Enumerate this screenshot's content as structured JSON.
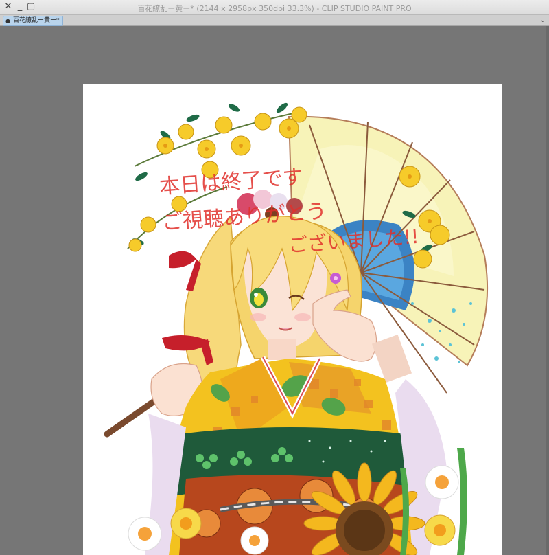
{
  "window": {
    "title": "百花繚乱ー黄ー* (2144 x 2958px 350dpi 33.3%)  - CLIP STUDIO PAINT PRO",
    "close_icon": "close-icon",
    "minimize_icon": "minimize-icon",
    "maximize_icon": "maximize-icon"
  },
  "tabs": [
    {
      "label": "百花繚乱ー黄ー*",
      "active": true
    }
  ],
  "tab_menu_icon": "chevron-down-icon",
  "canvas": {
    "background_color": "#767676",
    "paper_color": "#ffffff",
    "artwork_text": [
      "本日は終了です",
      "ご視聴ありがとう",
      "ございました!!"
    ],
    "artwork_text_color": "#e0302c"
  }
}
